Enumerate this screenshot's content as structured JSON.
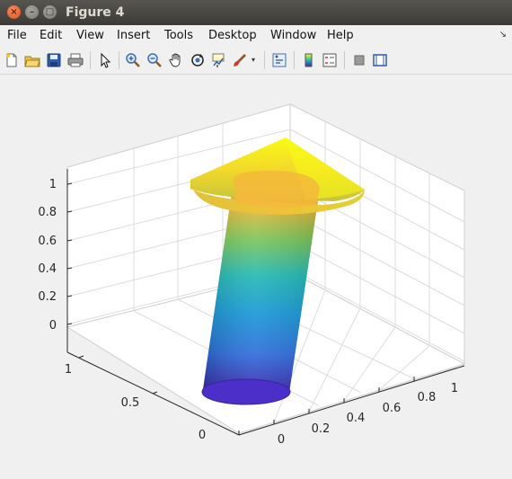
{
  "window": {
    "title": "Figure 4"
  },
  "menu": [
    "File",
    "Edit",
    "View",
    "Insert",
    "Tools",
    "Desktop",
    "Window",
    "Help"
  ],
  "toolbar": {
    "tools": [
      "new-figure-icon",
      "open-file-icon",
      "save-icon",
      "print-icon",
      "pointer-icon",
      "zoom-in-icon",
      "zoom-out-icon",
      "pan-hand-icon",
      "rotate-3d-icon",
      "data-cursor-icon",
      "brush-icon",
      "link-plot-icon",
      "colorbar-icon",
      "legend-icon",
      "hide-plot-tools-icon",
      "show-plot-tools-icon"
    ]
  },
  "chart_data": {
    "type": "surface",
    "title": "",
    "xlabel": "",
    "ylabel": "",
    "zlabel": "",
    "x_ticks": [
      "0",
      "0.2",
      "0.4",
      "0.6",
      "0.8",
      "1"
    ],
    "y_ticks": [
      "0",
      "0.5",
      "1"
    ],
    "z_ticks": [
      "0",
      "0.2",
      "0.4",
      "0.6",
      "0.8",
      "1"
    ],
    "xlim": [
      0,
      1
    ],
    "ylim": [
      0,
      1
    ],
    "zlim": [
      -0.1,
      1.1
    ],
    "grid": true,
    "colormap": "parula",
    "shape": "3D arrow: tilted cylinder shaft with cone head",
    "shaft": {
      "base_center": [
        0.5,
        0.5,
        0
      ],
      "top_center": [
        0.5,
        0.5,
        0.9
      ],
      "radius": 0.15
    },
    "head": {
      "base_z": 0.9,
      "tip_z": 1.1,
      "radius": 0.3
    }
  }
}
